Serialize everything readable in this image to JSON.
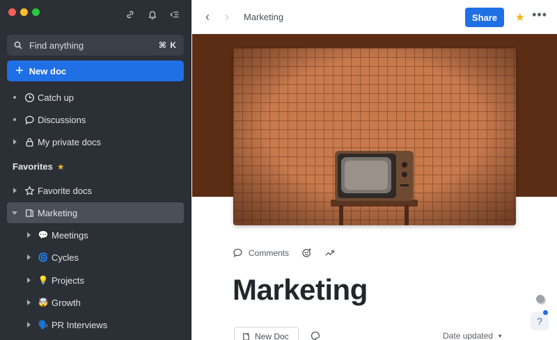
{
  "sidebar": {
    "search": {
      "placeholder": "Find anything",
      "shortcut": "⌘ K"
    },
    "new_doc_label": "New doc",
    "top_items": [
      {
        "label": "Catch up",
        "icon": "clock-icon"
      },
      {
        "label": "Discussions",
        "icon": "speech-bubble-icon"
      },
      {
        "label": "My private docs",
        "icon": "lock-icon"
      }
    ],
    "favorites_heading": "Favorites",
    "favorites": [
      {
        "label": "Favorite docs",
        "icon": "star-outline-icon"
      },
      {
        "label": "Marketing",
        "icon": "doc-book-icon",
        "selected": true
      }
    ],
    "sub_items": [
      {
        "label": "Meetings",
        "emoji": "💬"
      },
      {
        "label": "Cycles",
        "emoji": "🌀"
      },
      {
        "label": "Projects",
        "emoji": "💡"
      },
      {
        "label": "Growth",
        "emoji": "🤯"
      },
      {
        "label": "PR Interviews",
        "emoji": "🗣️"
      }
    ]
  },
  "header": {
    "breadcrumb": "Marketing",
    "share_label": "Share"
  },
  "doc": {
    "actions": {
      "comments_label": "Comments"
    },
    "title": "Marketing",
    "new_doc_label": "New Doc",
    "sort_label": "Date updated"
  },
  "help": {
    "label": "?"
  },
  "colors": {
    "sidebar_bg": "#2b2f36",
    "accent": "#1f6fe5",
    "favorite_star": "#f5b82e",
    "cover_band": "#5b2d14"
  }
}
